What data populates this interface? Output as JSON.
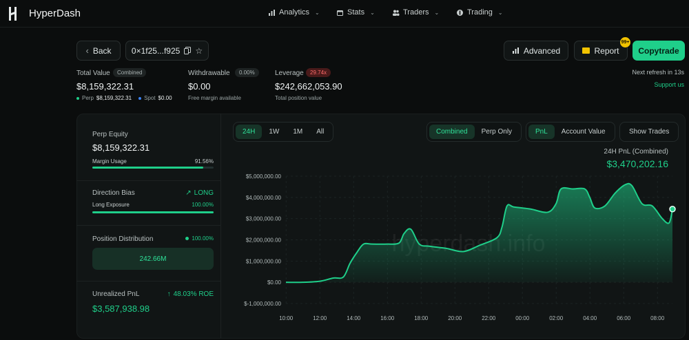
{
  "nav": {
    "brand": "HyperDash",
    "items": [
      {
        "label": "Analytics",
        "icon": "bar-chart-icon"
      },
      {
        "label": "Stats",
        "icon": "calendar-icon"
      },
      {
        "label": "Traders",
        "icon": "users-icon"
      },
      {
        "label": "Trading",
        "icon": "coin-icon"
      }
    ]
  },
  "toolbar": {
    "back_label": "Back",
    "address": "0×1f25...f925",
    "advanced_label": "Advanced",
    "report_label": "Report",
    "report_badge": "99+",
    "copytrade_label": "Copytrade"
  },
  "stats": {
    "total_value_label": "Total Value",
    "total_value_pill": "Combined",
    "total_value": "$8,159,322.31",
    "perp_label": "Perp",
    "perp_value": "$8,159,322.31",
    "spot_label": "Spot",
    "spot_value": "$0.00",
    "withdrawable_label": "Withdrawable",
    "withdrawable_pill": "0.00%",
    "withdrawable": "$0.00",
    "withdrawable_sub": "Free margin available",
    "leverage_label": "Leverage",
    "leverage_pill": "29.74x",
    "leverage": "$242,662,053.90",
    "leverage_sub": "Total position value",
    "refresh": "Next refresh in 13s",
    "support": "Support us"
  },
  "left": {
    "perp_equity_label": "Perp Equity",
    "perp_equity": "$8,159,322.31",
    "margin_usage_label": "Margin Usage",
    "margin_usage": "91.56%",
    "margin_usage_frac": 0.9156,
    "direction_label": "Direction Bias",
    "direction_value": "LONG",
    "long_exposure_label": "Long Exposure",
    "long_exposure": "100.00%",
    "long_exposure_frac": 1.0,
    "position_dist_label": "Position Distribution",
    "position_dist_pct": "100.00%",
    "position_dist_value": "242.66M",
    "upnl_label": "Unrealized PnL",
    "roe": "48.03% ROE",
    "upnl": "$3,587,938.98"
  },
  "chart_controls": {
    "ranges": [
      "24H",
      "1W",
      "1M",
      "All"
    ],
    "active_range": "24H",
    "scope": [
      "Combined",
      "Perp Only"
    ],
    "active_scope": "Combined",
    "metric": [
      "PnL",
      "Account Value"
    ],
    "active_metric": "PnL",
    "show_trades": "Show Trades",
    "summary_label": "24H PnL (Combined)",
    "summary_value": "$3,470,202.16",
    "watermark": "hyperdash.info"
  },
  "colors": {
    "accent": "#1fcf8a",
    "bg": "#0b0d0d",
    "card": "#111515",
    "warn": "#f2c300"
  },
  "chart_data": {
    "type": "area",
    "x_ticks": [
      "10:00",
      "12:00",
      "14:00",
      "16:00",
      "18:00",
      "20:00",
      "22:00",
      "00:00",
      "02:00",
      "04:00",
      "06:00",
      "08:00"
    ],
    "y_ticks": [
      "$5,000,000.00",
      "$4,000,000.00",
      "$3,000,000.00",
      "$2,000,000.00",
      "$1,000,000.00",
      "$0.00",
      "$-1,000,000.00"
    ],
    "ylim": [
      -1000000,
      5000000
    ],
    "grid": true,
    "series": [
      {
        "x": [
          9.5,
          10.5,
          11.5,
          12.3,
          12.9,
          13.3,
          13.7,
          14.1,
          14.6,
          15.5,
          16.2,
          16.5,
          16.9,
          17.4,
          18.0,
          19.0,
          20.0,
          21.0,
          22.0,
          22.3,
          22.6,
          23.0,
          24.0,
          25.0,
          25.5,
          25.8,
          26.5,
          27.2,
          27.5,
          27.8,
          28.4,
          29.0,
          29.6,
          30.0,
          30.6,
          31.2,
          31.8,
          32.2,
          32.4
        ],
        "y": [
          0,
          0,
          50000,
          200000,
          250000,
          900000,
          1400000,
          1800000,
          1800000,
          1800000,
          1850000,
          2300000,
          2500000,
          1800000,
          1700000,
          1600000,
          1450000,
          1750000,
          2100000,
          2600000,
          3600000,
          3550000,
          3450000,
          3300000,
          3700000,
          4400000,
          4400000,
          4400000,
          4000000,
          3500000,
          3600000,
          4200000,
          4600000,
          4550000,
          3700000,
          3600000,
          3000000,
          2800000,
          3450000
        ]
      }
    ]
  }
}
